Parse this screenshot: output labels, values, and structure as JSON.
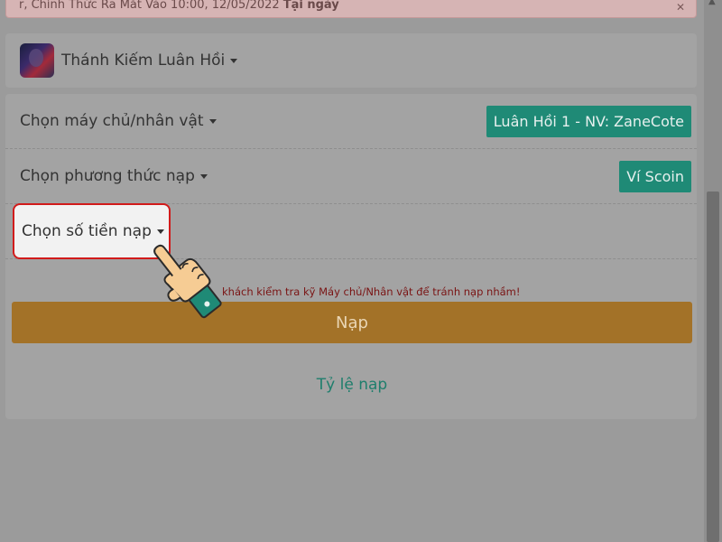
{
  "notice": {
    "text": "r, Chính Thức Ra Mắt Vào 10:00, 12/05/2022",
    "bold": "Tại ngày",
    "close": "✕"
  },
  "game": {
    "name": "Thánh Kiếm Luân Hồi"
  },
  "rows": {
    "server": {
      "label": "Chọn máy chủ/nhân vật",
      "value": "Luân Hồi 1 - NV: ZaneCote"
    },
    "method": {
      "label": "Chọn phương thức nạp",
      "value": "Ví Scoin"
    },
    "amount": {
      "label": "Chọn số tiền nạp"
    }
  },
  "warning": "khách kiểm tra kỹ Máy chủ/Nhân vật để tránh nạp nhầm!",
  "submit_label": "Nạp",
  "rate_link": "Tỷ lệ nạp",
  "colors": {
    "accent_teal": "#1f8a76",
    "button_gold": "#a37228",
    "highlight_red": "#d11b1b"
  }
}
